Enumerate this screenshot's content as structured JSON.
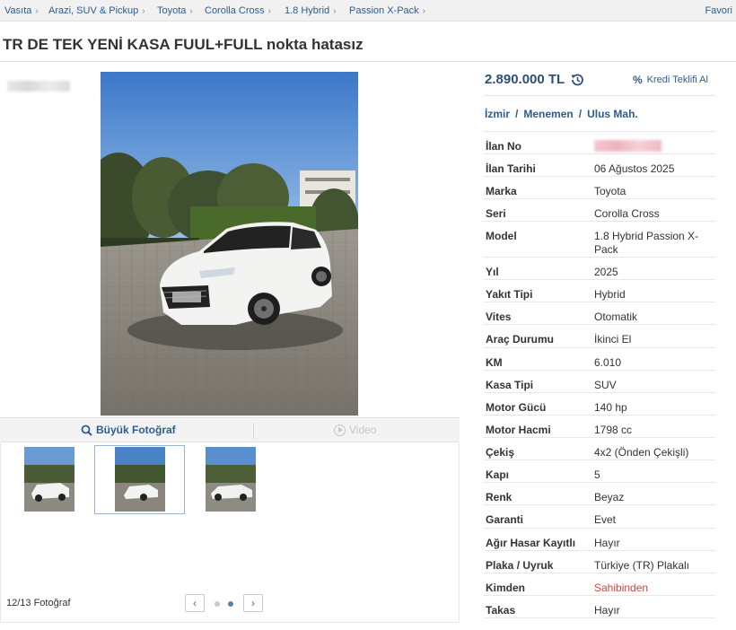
{
  "breadcrumb": {
    "items": [
      "Vasıta",
      "Arazi, SUV & Pickup",
      "Toyota",
      "Corolla Cross",
      "1.8 Hybrid",
      "Passion X-Pack"
    ],
    "favorites_label": "Favori"
  },
  "title": "TR DE TEK YENİ KASA FUUL+FULL nokta hatasız",
  "price": {
    "value": "2.890.000 TL",
    "icon": "price-history-icon",
    "kredi_label": "Kredi Teklifi Al"
  },
  "location": [
    "İzmir",
    "Menemen",
    "Ulus Mah."
  ],
  "specs": [
    {
      "key": "İlan No",
      "value": "",
      "blurred": true
    },
    {
      "key": "İlan Tarihi",
      "value": "06 Ağustos 2025"
    },
    {
      "key": "Marka",
      "value": "Toyota"
    },
    {
      "key": "Seri",
      "value": "Corolla Cross"
    },
    {
      "key": "Model",
      "value": "1.8 Hybrid Passion X-Pack"
    },
    {
      "key": "Yıl",
      "value": "2025"
    },
    {
      "key": "Yakıt Tipi",
      "value": "Hybrid"
    },
    {
      "key": "Vites",
      "value": "Otomatik"
    },
    {
      "key": "Araç Durumu",
      "value": "İkinci El"
    },
    {
      "key": "KM",
      "value": "6.010"
    },
    {
      "key": "Kasa Tipi",
      "value": "SUV"
    },
    {
      "key": "Motor Gücü",
      "value": "140 hp"
    },
    {
      "key": "Motor Hacmi",
      "value": "1798 cc"
    },
    {
      "key": "Çekiş",
      "value": "4x2 (Önden Çekişli)"
    },
    {
      "key": "Kapı",
      "value": "5"
    },
    {
      "key": "Renk",
      "value": "Beyaz"
    },
    {
      "key": "Garanti",
      "value": "Evet"
    },
    {
      "key": "Ağır Hasar Kayıtlı",
      "value": "Hayır"
    },
    {
      "key": "Plaka / Uyruk",
      "value": "Türkiye (TR) Plakalı"
    },
    {
      "key": "Kimden",
      "value": "Sahibinden",
      "highlight": "#d0453d"
    },
    {
      "key": "Takas",
      "value": "Hayır"
    }
  ],
  "gallery": {
    "big_photo_label": "Büyük Fotoğraf",
    "video_label": "Video",
    "photo_count": "12/13 Fotoğraf",
    "thumbnail_count": 3,
    "selected_thumbnail": 2,
    "pager_dots": 2,
    "active_dot": 2
  },
  "colors": {
    "link": "#2d5c8f",
    "price": "#2d4f7c",
    "seller_highlight": "#d0453d"
  }
}
